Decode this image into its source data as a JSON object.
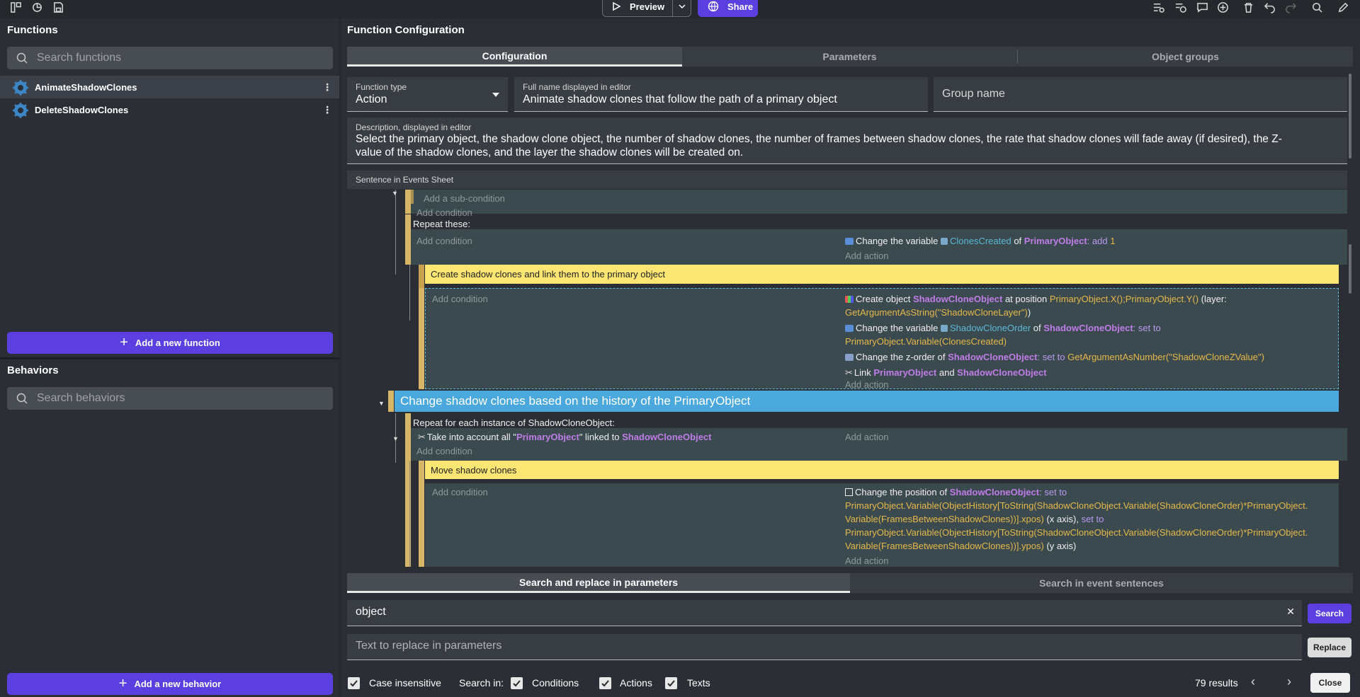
{
  "toolbar": {
    "preview_label": "Preview",
    "share_label": "Share"
  },
  "functions_panel": {
    "title": "Functions",
    "search_placeholder": "Search functions",
    "items": [
      {
        "name": "AnimateShadowClones",
        "selected": true
      },
      {
        "name": "DeleteShadowClones",
        "selected": false
      }
    ],
    "add_label": "Add a new function"
  },
  "behaviors_panel": {
    "title": "Behaviors",
    "search_placeholder": "Search behaviors",
    "add_label": "Add a new behavior"
  },
  "config": {
    "title": "Function Configuration",
    "tabs": [
      "Configuration",
      "Parameters",
      "Object groups"
    ],
    "function_type_label": "Function type",
    "function_type_value": "Action",
    "full_name_label": "Full name displayed in editor",
    "full_name_value": "Animate shadow clones that follow the path of a primary object",
    "group_name_placeholder": "Group name",
    "description_label": "Description, displayed in editor",
    "description_line1": "Select the primary object, the shadow clone object, the number of shadow clones, the number of frames between shadow clones, the rate that shadow clones will fade away (if desired), the Z-",
    "description_line2": "value of the shadow clones, and the layer the shadow clones will be created on.",
    "sentence_label": "Sentence in Events Sheet"
  },
  "events": {
    "add_subcondition": "Add a sub-condition",
    "add_condition": "Add condition",
    "add_action": "Add action",
    "repeat_these": "Repeat these:",
    "action1": {
      "pre": "Change the variable ",
      "var": "ClonesCreated",
      "mid": " of ",
      "obj": "PrimaryObject",
      "op": ": add ",
      "val": "1"
    },
    "comment1": "Create shadow clones and link them to the primary object",
    "create": {
      "pre": "Create object ",
      "obj": "ShadowCloneObject",
      "mid": " at position ",
      "pos": "PrimaryObject.X();PrimaryObject.Y()",
      "layer": " (layer:",
      "layer_val": "GetArgumentAsString(\"ShadowCloneLayer\")",
      "close": ")"
    },
    "change_var2": {
      "pre": "Change the variable ",
      "var": "ShadowCloneOrder",
      "mid": " of ",
      "obj": "ShadowCloneObject",
      "op": ": set to",
      "val": "PrimaryObject.Variable(ClonesCreated)"
    },
    "zorder": {
      "pre": "Change the z-order of ",
      "obj": "ShadowCloneObject",
      "op": ": set to ",
      "val": "GetArgumentAsNumber(\"ShadowCloneZValue\")"
    },
    "link": {
      "pre": "Link ",
      "a": "PrimaryObject",
      "mid": " and ",
      "b": "ShadowCloneObject"
    },
    "group_title": "Change shadow clones based on the history of the PrimaryObject",
    "repeat_each": "Repeat for each instance of ShadowCloneObject:",
    "take_account": {
      "pre": "Take into account all \"",
      "a": "PrimaryObject",
      "mid": "\" linked to ",
      "b": "ShadowCloneObject"
    },
    "comment2": "Move shadow clones",
    "position": {
      "pre": "Change the position of ",
      "obj": "ShadowCloneObject",
      "op1": ": set to",
      "l1": "PrimaryObject.Variable(ObjectHistory[ToString(ShadowCloneObject.Variable(ShadowCloneOrder)*PrimaryObject.",
      "l2": "Variable(FramesBetweenShadowClones))].xpos)",
      "l2b": " (x axis), ",
      "l2c": "set to",
      "l3": "PrimaryObject.Variable(ObjectHistory[ToString(ShadowCloneObject.Variable(ShadowCloneOrder)*PrimaryObject.",
      "l4": "Variable(FramesBetweenShadowClones))].ypos)",
      "l4b": " (y axis)"
    }
  },
  "search_panel": {
    "tabs": [
      "Search and replace in parameters",
      "Search in event sentences"
    ],
    "search_value": "object",
    "search_button": "Search",
    "replace_placeholder": "Text to replace in parameters",
    "replace_button": "Replace",
    "case_label": "Case insensitive",
    "search_in_label": "Search in:",
    "conditions_label": "Conditions",
    "actions_label": "Actions",
    "texts_label": "Texts",
    "results": "79 results",
    "close_label": "Close"
  },
  "colors": {
    "accent": "#5b3fe0",
    "group": "#4aa8dd",
    "comment": "#fbe573",
    "event_bar": "#d6b566"
  }
}
